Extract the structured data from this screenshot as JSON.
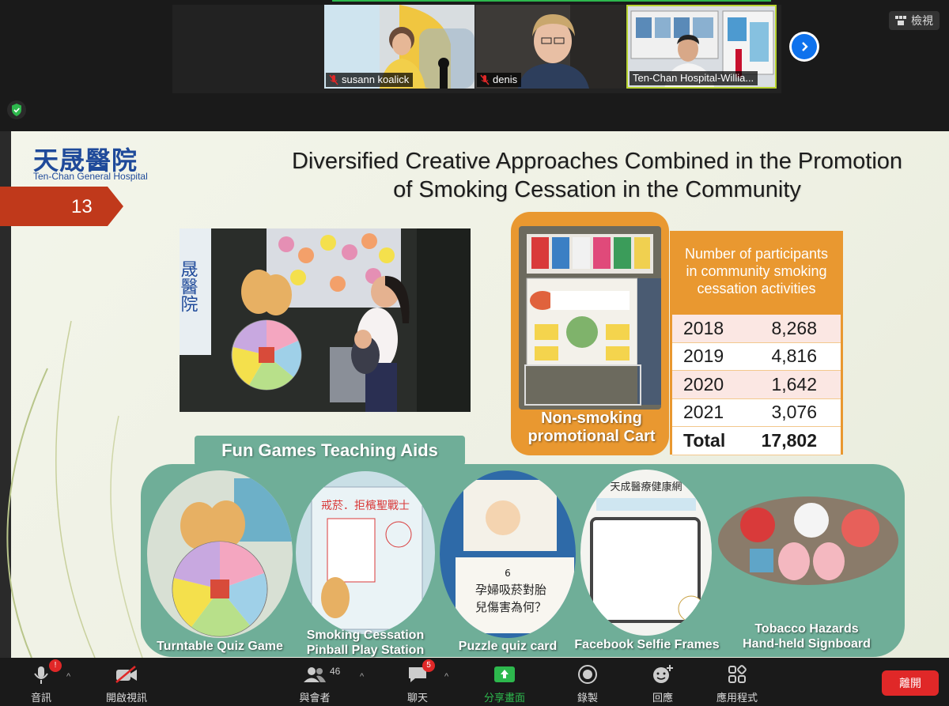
{
  "meeting": {
    "view_label": "檢視",
    "participants": [
      {
        "name": "susann koalick"
      },
      {
        "name": "denis"
      },
      {
        "name": "Ten-Chan Hospital-Willia..."
      }
    ]
  },
  "slide": {
    "logo_cn": "天晟醫院",
    "logo_en": "Ten-Chan General Hospital",
    "page_number": "13",
    "title_line1": "Diversified Creative Approaches Combined in the Promotion",
    "title_line2": "of Smoking Cessation in the Community",
    "cart_caption_line1": "Non-smoking",
    "cart_caption_line2": "promotional Cart",
    "stats": {
      "header_line1": "Number of participants",
      "header_line2": "in community smoking",
      "header_line3": "cessation activities",
      "rows": [
        {
          "year": "2018",
          "value": "8,268"
        },
        {
          "year": "2019",
          "value": "4,816"
        },
        {
          "year": "2020",
          "value": "1,642"
        },
        {
          "year": "2021",
          "value": "3,076"
        }
      ],
      "total_label": "Total",
      "total_value": "17,802"
    },
    "games_label": "Fun Games Teaching Aids",
    "games": [
      {
        "caption_line1": "Turntable Quiz Game",
        "caption_line2": ""
      },
      {
        "caption_line1": "Smoking Cessation",
        "caption_line2": "Pinball Play Station"
      },
      {
        "caption_line1": "Puzzle quiz card",
        "caption_line2": ""
      },
      {
        "caption_line1": "Facebook Selfie Frames",
        "caption_line2": ""
      },
      {
        "caption_line1": "Tobacco Hazards",
        "caption_line2": "Hand-held Signboard"
      }
    ],
    "photo_texts": {
      "pinball_title": "戒菸．拒檳聖戰士",
      "quiz_line1": "孕婦吸菸對胎",
      "quiz_line2": "兒傷害為何？",
      "quiz_number": "6",
      "selfie_title": "天成醫療健康網",
      "hospital_wall": "晟醫院"
    }
  },
  "toolbar": {
    "audio_label": "音訊",
    "video_label": "開啟視訊",
    "participants_label": "與會者",
    "participants_count": "46",
    "chat_label": "聊天",
    "chat_badge": "5",
    "share_label": "分享畫面",
    "record_label": "錄製",
    "reactions_label": "回應",
    "apps_label": "應用程式",
    "leave_label": "離開"
  },
  "colors": {
    "accent_orange": "#e99830",
    "panel_green": "#6fae98",
    "flag_red": "#c0391b",
    "logo_blue": "#1f4a9a",
    "share_green": "#2db84d",
    "leave_red": "#e02828"
  }
}
